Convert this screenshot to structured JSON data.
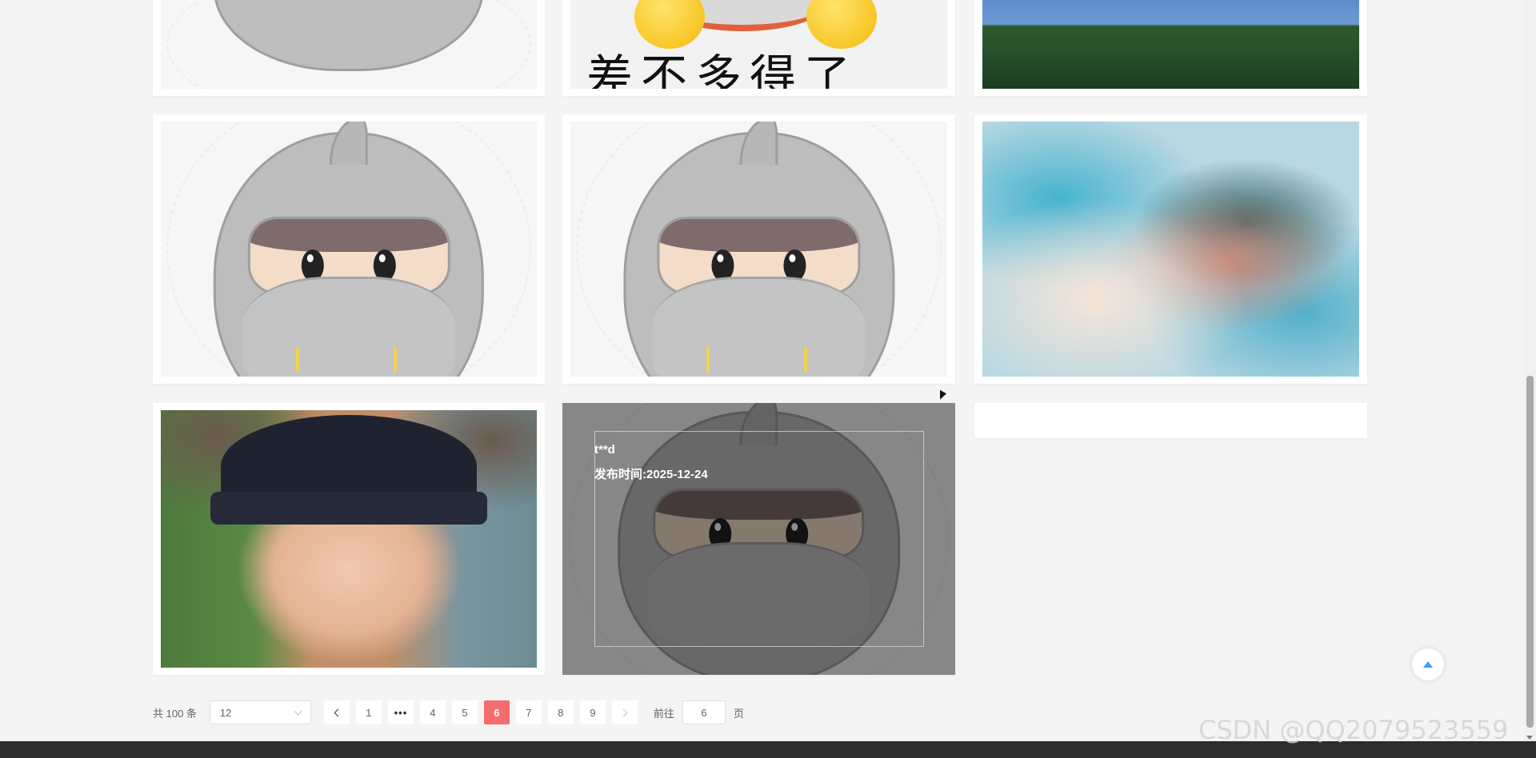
{
  "gallery": {
    "hovered_item": {
      "title": "t**d",
      "publish_label": "发布时间:2025-12-24"
    },
    "cards": [
      {
        "kind": "ninja-avatar"
      },
      {
        "kind": "emoji",
        "text": "差不多得了"
      },
      {
        "kind": "landscape"
      },
      {
        "kind": "ninja-avatar"
      },
      {
        "kind": "ninja-avatar"
      },
      {
        "kind": "painting"
      },
      {
        "kind": "photo"
      },
      {
        "kind": "ninja-avatar-hovered"
      },
      {
        "kind": "empty"
      }
    ]
  },
  "pagination": {
    "total_label": "共 100 条",
    "page_size": "12",
    "first_page": "1",
    "more": "•••",
    "pages": [
      "4",
      "5",
      "6",
      "7",
      "8",
      "9"
    ],
    "current_page": "6",
    "goto_prefix": "前往",
    "goto_value": "6",
    "goto_suffix": "页"
  },
  "watermark": "CSDN @QQ2079523559",
  "colors": {
    "active_page": "#f56c6c",
    "back_top_icon": "#409eff",
    "page_bg": "#f5f4f4"
  },
  "icons": {
    "prev": "chevron-left-icon",
    "next": "chevron-right-icon",
    "select": "chevron-down-icon",
    "back_top": "caret-up-icon"
  }
}
